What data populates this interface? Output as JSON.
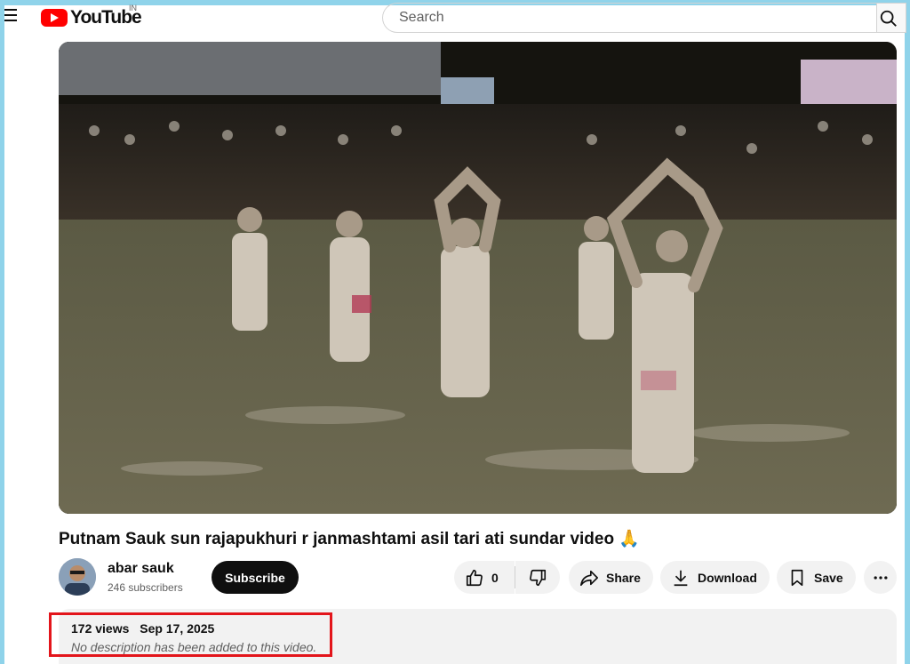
{
  "header": {
    "logo_text": "YouTube",
    "region": "IN",
    "search_placeholder": "Search"
  },
  "video": {
    "title": "Putnam Sauk sun rajapukhuri r janmashtami asil tari ati sundar video 🙏"
  },
  "channel": {
    "name": "abar sauk",
    "subscribers": "246 subscribers",
    "subscribe_label": "Subscribe"
  },
  "actions": {
    "like_count": "0",
    "share_label": "Share",
    "download_label": "Download",
    "save_label": "Save"
  },
  "description": {
    "views": "172 views",
    "date": "Sep 17, 2025",
    "empty_text": "No description has been added to this video."
  },
  "colors": {
    "brand_red": "#ff0000",
    "highlight_red": "#e3151b",
    "frame": "#8fd3ea"
  },
  "icons": [
    "menu-icon",
    "youtube-play-icon",
    "search-icon",
    "thumbs-up-icon",
    "thumbs-down-icon",
    "share-icon",
    "download-icon",
    "bookmark-icon",
    "more-icon"
  ]
}
